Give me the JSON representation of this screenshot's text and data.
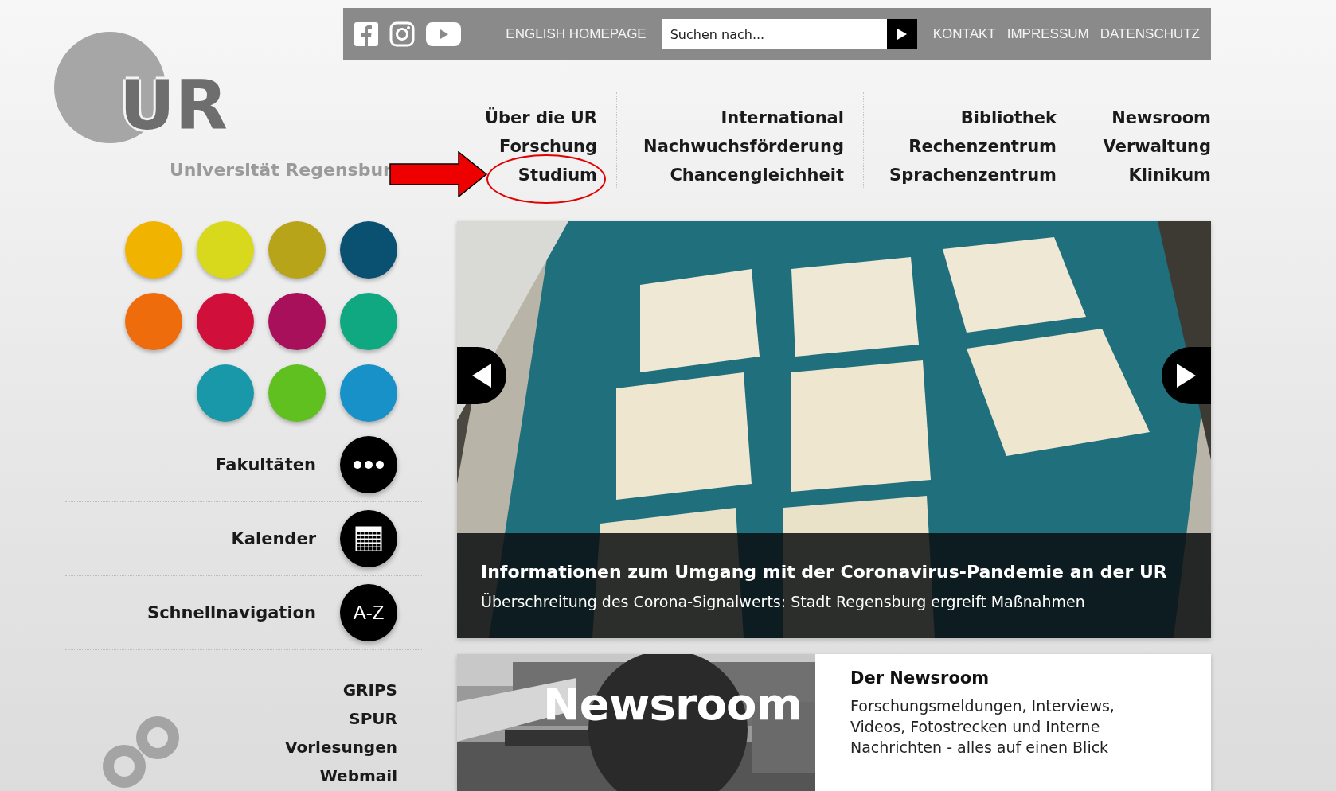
{
  "social_icons": [
    {
      "kind": "facebook"
    },
    {
      "kind": "instagram"
    },
    {
      "kind": "youtube"
    }
  ],
  "top_links_left": [
    "ENGLISH HOMEPAGE"
  ],
  "search": {
    "placeholder": "Suchen nach..."
  },
  "top_links_right": [
    "KONTAKT",
    "IMPRESSUM",
    "DATENSCHUTZ"
  ],
  "logo": {
    "letters": "UR",
    "name": "Universität Regensbur"
  },
  "main_nav": [
    [
      {
        "label": "Über die UR",
        "annotated": false
      },
      {
        "label": "Forschung",
        "annotated": false
      },
      {
        "label": "Studium",
        "annotated": true
      }
    ],
    [
      {
        "label": "International",
        "annotated": false
      },
      {
        "label": "Nachwuchsförderung",
        "annotated": false
      },
      {
        "label": "Chancengleichheit",
        "annotated": false
      }
    ],
    [
      {
        "label": "Bibliothek",
        "annotated": false
      },
      {
        "label": "Rechenzentrum",
        "annotated": false
      },
      {
        "label": "Sprachenzentrum",
        "annotated": false
      }
    ],
    [
      {
        "label": "Newsroom",
        "annotated": false
      },
      {
        "label": "Verwaltung",
        "annotated": false
      },
      {
        "label": "Klinikum",
        "annotated": false
      }
    ]
  ],
  "faculty_dots": [
    {
      "color": "#f0b400"
    },
    {
      "color": "#d8d81c"
    },
    {
      "color": "#b8a418"
    },
    {
      "color": "#0a5070"
    },
    {
      "color": "#ef6c0c"
    },
    {
      "color": "#d0103a"
    },
    {
      "color": "#a8105c"
    },
    {
      "color": "#10a880"
    },
    {
      "color": "#1898a8"
    },
    {
      "color": "#60c020"
    },
    {
      "color": "#1890c8"
    }
  ],
  "quick_links": [
    {
      "label": "Fakultäten",
      "kind": "dots"
    },
    {
      "label": "Kalender",
      "kind": "calendar"
    },
    {
      "label": "Schnellnavigation",
      "kind": "text",
      "badge": "A-Z"
    }
  ],
  "service_links": [
    "GRIPS",
    "SPUR",
    "Vorlesungen",
    "Webmail"
  ],
  "slider": {
    "title": "Informationen zum Umgang mit der Coronavirus-Pandemie an der UR",
    "subtitle": "Überschreitung des Corona-Signalwerts: Stadt Regensburg ergreift Maßnahmen"
  },
  "newsroom_teaser": {
    "banner_text": "Newsroom",
    "title": "Der Newsroom",
    "text": "Forschungsmeldungen, Interviews, Videos, Fotostrecken und Interne Nachrichten - alles auf einen Blick"
  }
}
